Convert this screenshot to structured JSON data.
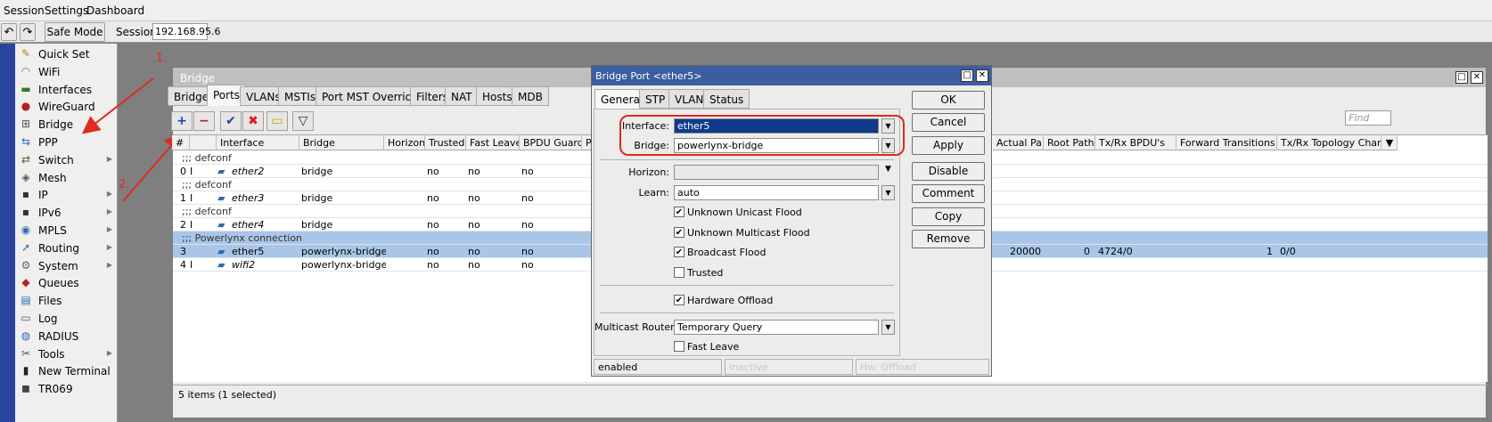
{
  "menu": [
    "Session",
    "Settings",
    "Dashboard"
  ],
  "toolbar": {
    "safe_mode": "Safe Mode",
    "session_label": "Session:",
    "session_value": "192.168.95.6"
  },
  "sidebar": {
    "items": [
      {
        "label": "Quick Set",
        "icon": "wand-icon",
        "glyph": "✎",
        "color": "#b07a20",
        "sub": false
      },
      {
        "label": "WiFi",
        "icon": "wifi-icon",
        "glyph": "◠",
        "color": "#7a7a7a",
        "sub": false
      },
      {
        "label": "Interfaces",
        "icon": "interfaces-icon",
        "glyph": "▬",
        "color": "#2e7a2e",
        "sub": false
      },
      {
        "label": "WireGuard",
        "icon": "wireguard-icon",
        "glyph": "●",
        "color": "#b52020",
        "sub": false
      },
      {
        "label": "Bridge",
        "icon": "bridge-icon",
        "glyph": "⊞",
        "color": "#555",
        "sub": false
      },
      {
        "label": "PPP",
        "icon": "ppp-icon",
        "glyph": "⇆",
        "color": "#2a6ab0",
        "sub": false
      },
      {
        "label": "Switch",
        "icon": "switch-icon",
        "glyph": "⇄",
        "color": "#3a6a3a",
        "sub": true
      },
      {
        "label": "Mesh",
        "icon": "mesh-icon",
        "glyph": "◈",
        "color": "#555",
        "sub": false
      },
      {
        "label": "IP",
        "icon": "ip-icon",
        "glyph": "▪",
        "color": "#333",
        "sub": true
      },
      {
        "label": "IPv6",
        "icon": "ipv6-icon",
        "glyph": "▪",
        "color": "#333",
        "sub": true
      },
      {
        "label": "MPLS",
        "icon": "mpls-icon",
        "glyph": "◉",
        "color": "#2a6ab0",
        "sub": true
      },
      {
        "label": "Routing",
        "icon": "routing-icon",
        "glyph": "➚",
        "color": "#2a6ab0",
        "sub": true
      },
      {
        "label": "System",
        "icon": "system-icon",
        "glyph": "⚙",
        "color": "#666",
        "sub": true
      },
      {
        "label": "Queues",
        "icon": "queues-icon",
        "glyph": "◆",
        "color": "#b52020",
        "sub": false
      },
      {
        "label": "Files",
        "icon": "files-icon",
        "glyph": "▤",
        "color": "#2a6ab0",
        "sub": false
      },
      {
        "label": "Log",
        "icon": "log-icon",
        "glyph": "▭",
        "color": "#555",
        "sub": false
      },
      {
        "label": "RADIUS",
        "icon": "radius-icon",
        "glyph": "◍",
        "color": "#2a6ab0",
        "sub": false
      },
      {
        "label": "Tools",
        "icon": "tools-icon",
        "glyph": "✂",
        "color": "#555",
        "sub": true
      },
      {
        "label": "New Terminal",
        "icon": "terminal-icon",
        "glyph": "▮",
        "color": "#222",
        "sub": false
      },
      {
        "label": "TR069",
        "icon": "tr069-icon",
        "glyph": "◼",
        "color": "#444",
        "sub": false
      }
    ]
  },
  "annotations": {
    "step1": "1.",
    "step2": "2."
  },
  "bridge_window": {
    "title": "Bridge",
    "tabs": [
      "Bridge",
      "Ports",
      "VLANs",
      "MSTIs",
      "Port MST Overrides",
      "Filters",
      "NAT",
      "Hosts",
      "MDB"
    ],
    "active_tab": "Ports",
    "find_placeholder": "Find",
    "columns_left": [
      "#",
      "",
      "Interface",
      "Bridge",
      "Horizon",
      "Trusted",
      "Fast Leave",
      "BPDU Guard",
      "P"
    ],
    "columns_right": [
      "Actual Pa...",
      "Root Path...",
      "Tx/Rx BPDU's",
      "Forward Transitions",
      "Tx/Rx Topology Chan..."
    ],
    "rows": [
      {
        "type": "comment",
        "text": ";;; defconf"
      },
      {
        "type": "data",
        "num": "0",
        "flag": "I",
        "iface": "ether2",
        "italic": true,
        "bridge": "bridge",
        "trusted": "no",
        "fast_leave": "no",
        "bpdu": "no",
        "actual": "",
        "root": "",
        "txrx": "",
        "fwd": "",
        "topo": "",
        "selected": false
      },
      {
        "type": "comment",
        "text": ";;; defconf"
      },
      {
        "type": "data",
        "num": "1",
        "flag": "I",
        "iface": "ether3",
        "italic": true,
        "bridge": "bridge",
        "trusted": "no",
        "fast_leave": "no",
        "bpdu": "no",
        "actual": "",
        "root": "",
        "txrx": "",
        "fwd": "",
        "topo": "",
        "selected": false
      },
      {
        "type": "comment",
        "text": ";;; defconf"
      },
      {
        "type": "data",
        "num": "2",
        "flag": "I",
        "iface": "ether4",
        "italic": true,
        "bridge": "bridge",
        "trusted": "no",
        "fast_leave": "no",
        "bpdu": "no",
        "actual": "",
        "root": "",
        "txrx": "",
        "fwd": "",
        "topo": "",
        "selected": false
      },
      {
        "type": "comment",
        "text": ";;; Powerlynx connection",
        "selected": true
      },
      {
        "type": "data",
        "num": "3",
        "flag": "",
        "iface": "ether5",
        "italic": false,
        "bridge": "powerlynx-bridge",
        "trusted": "no",
        "fast_leave": "no",
        "bpdu": "no",
        "actual": "20000",
        "root": "0",
        "txrx": "4724/0",
        "fwd": "1",
        "topo": "0/0",
        "selected": true
      },
      {
        "type": "data",
        "num": "4",
        "flag": "I",
        "iface": "wifi2",
        "italic": true,
        "bridge": "powerlynx-bridge",
        "trusted": "no",
        "fast_leave": "no",
        "bpdu": "no",
        "actual": "",
        "root": "",
        "txrx": "",
        "fwd": "",
        "topo": "",
        "selected": false
      }
    ],
    "status": "5 items (1 selected)"
  },
  "dialog": {
    "title": "Bridge Port <ether5>",
    "tabs": [
      "General",
      "STP",
      "VLAN",
      "Status"
    ],
    "active_tab": "General",
    "interface_label": "Interface:",
    "interface_value": "ether5",
    "bridge_label": "Bridge:",
    "bridge_value": "powerlynx-bridge",
    "horizon_label": "Horizon:",
    "horizon_value": "",
    "learn_label": "Learn:",
    "learn_value": "auto",
    "checks": [
      {
        "label": "Unknown Unicast Flood",
        "checked": true
      },
      {
        "label": "Unknown Multicast Flood",
        "checked": true
      },
      {
        "label": "Broadcast Flood",
        "checked": true
      },
      {
        "label": "Trusted",
        "checked": false
      }
    ],
    "hw_offload": {
      "label": "Hardware Offload",
      "checked": true
    },
    "multicast_label": "Multicast Router:",
    "multicast_value": "Temporary Query",
    "fast_leave": {
      "label": "Fast Leave",
      "checked": false
    },
    "buttons": [
      "OK",
      "Cancel",
      "Apply",
      "Disable",
      "Comment",
      "Copy",
      "Remove"
    ],
    "status": [
      "enabled",
      "inactive",
      "Hw. Offload"
    ]
  },
  "colors": {
    "accent_red": "#e0291f",
    "selection": "#a9c6e8",
    "title_blue": "#3a5ea0",
    "sidebar_strip": "#2a42a0"
  }
}
